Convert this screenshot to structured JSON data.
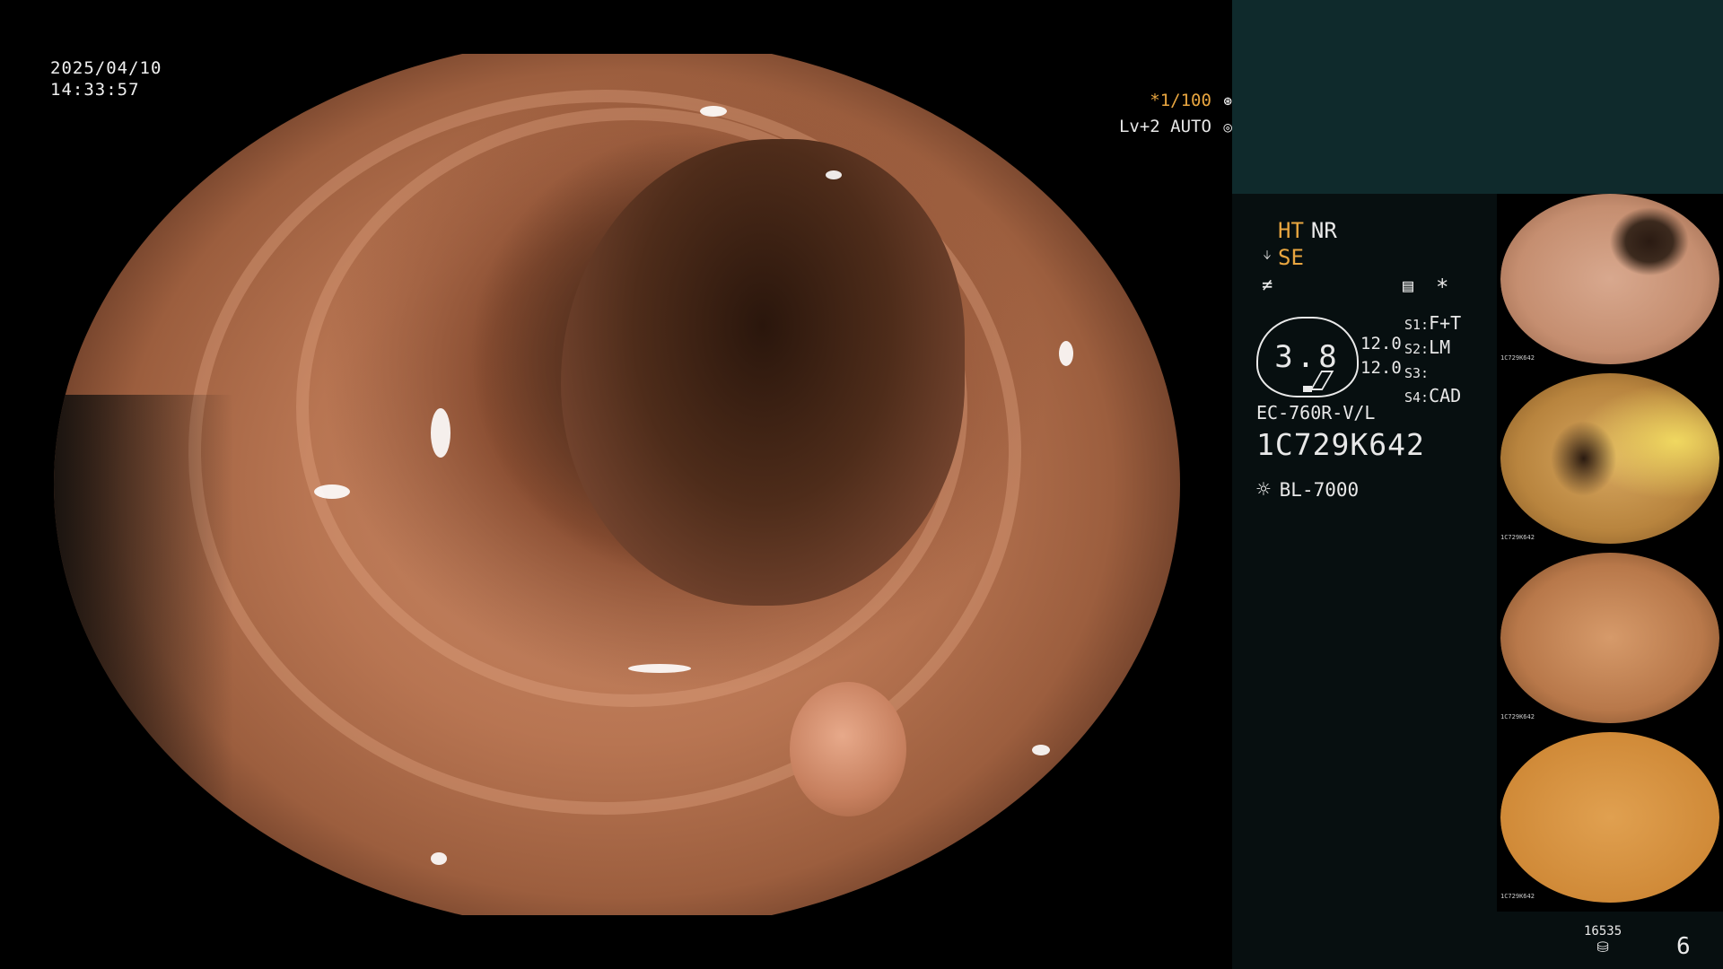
{
  "overlay": {
    "date": "2025/04/10",
    "time": "14:33:57",
    "shutter": "*1/100",
    "shutter_icon": "aperture-icon",
    "level": "Lv+2 AUTO",
    "level_icon": "auto-exposure-icon"
  },
  "settings": {
    "ht": "HT",
    "nr": "NR",
    "se": "SE",
    "se_icon": "structure-enhancement-icon",
    "freeze_icon": "freeze-icon",
    "menu_icon": "menu-icon",
    "star": "*"
  },
  "gauge": {
    "value": "3.8",
    "val1": "12.0",
    "val2": "12.0"
  },
  "slots": {
    "s1_label": "S1:",
    "s1": "F+T",
    "s2_label": "S2:",
    "s2": "LM",
    "s3_label": "S3:",
    "s3": "",
    "s4_label": "S4:",
    "s4": "CAD"
  },
  "scope": {
    "model": "EC-760R-V/L",
    "serial": "1C729K642",
    "light_source": "BL-7000",
    "light_icon": "sun-icon"
  },
  "thumbnails": [
    {
      "caption": "1C729K642"
    },
    {
      "caption": "1C729K642"
    },
    {
      "caption": "1C729K642"
    },
    {
      "caption": "1C729K642"
    }
  ],
  "footer": {
    "count": "16535",
    "count_icon": "database-icon",
    "page": "6"
  }
}
